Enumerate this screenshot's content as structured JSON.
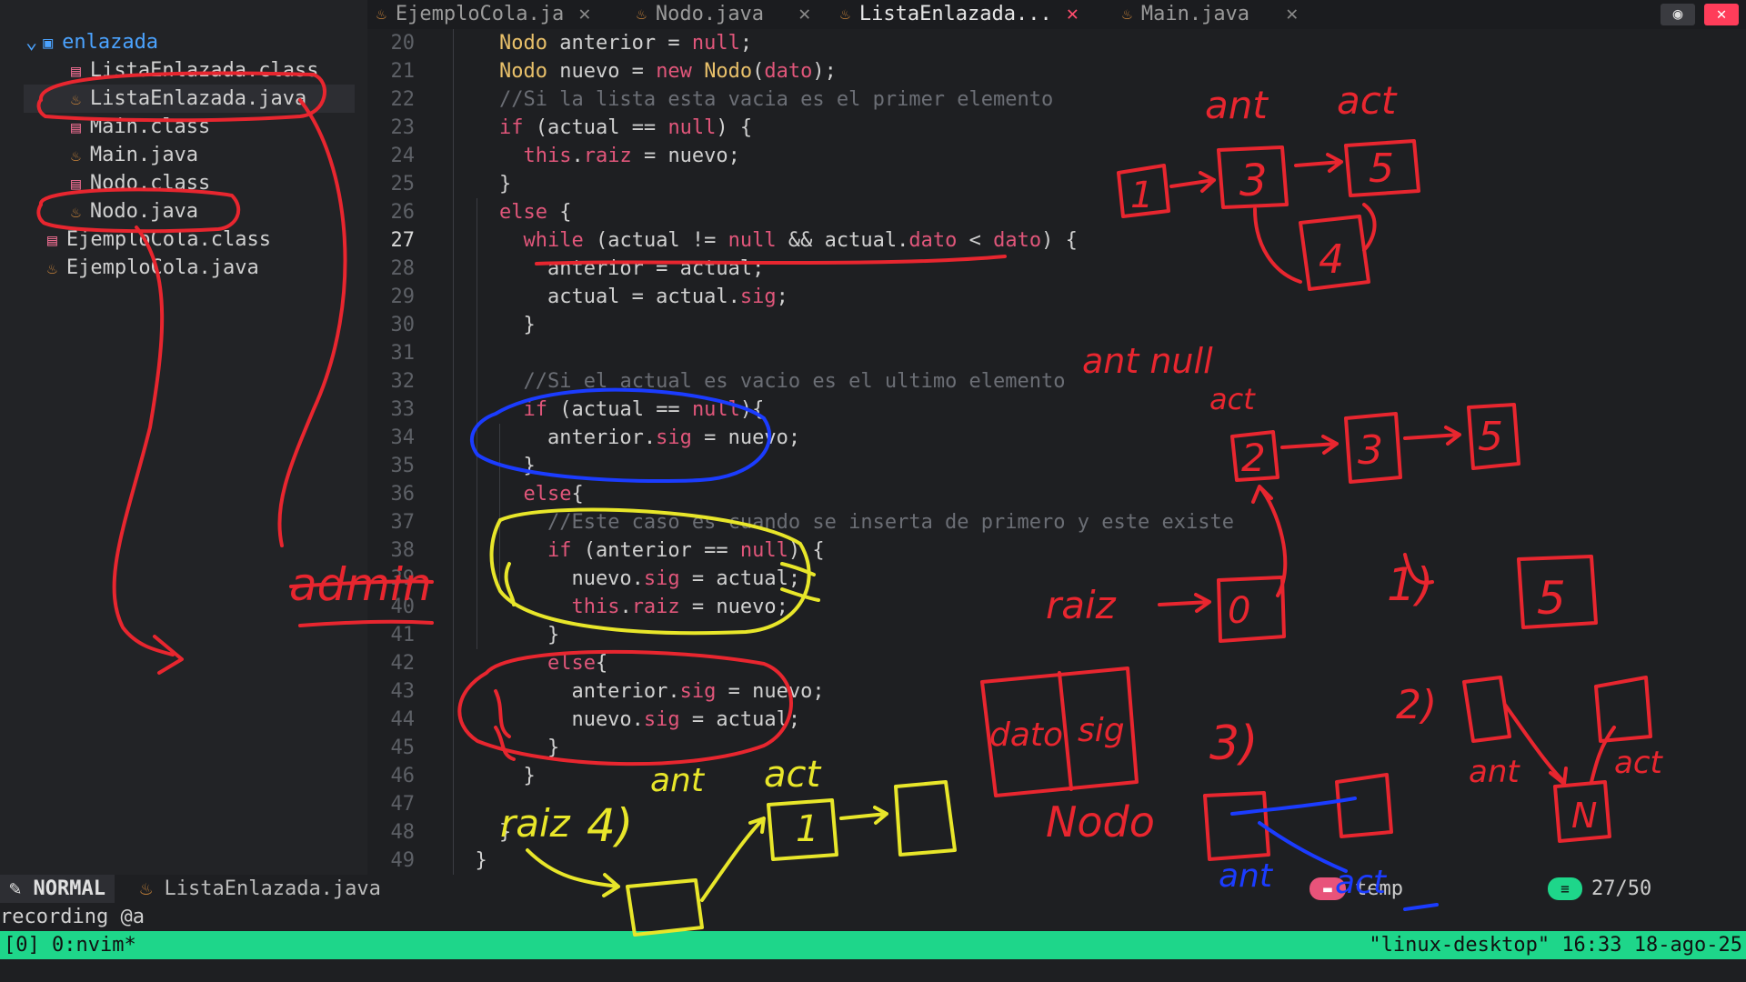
{
  "sidebar": {
    "folder": "enlazada",
    "items": [
      {
        "label": "ListaEnlazada.class",
        "kind": "class"
      },
      {
        "label": "ListaEnlazada.java",
        "kind": "java"
      },
      {
        "label": "Main.class",
        "kind": "class"
      },
      {
        "label": "Main.java",
        "kind": "java"
      },
      {
        "label": "Nodo.class",
        "kind": "class"
      },
      {
        "label": "Nodo.java",
        "kind": "java"
      },
      {
        "label": "EjemploCola.class",
        "kind": "class"
      },
      {
        "label": "EjemploCola.java",
        "kind": "java"
      }
    ]
  },
  "tabs": [
    {
      "label": "EjemploCola.ja",
      "active": false
    },
    {
      "label": "Nodo.java",
      "active": false
    },
    {
      "label": "ListaEnlazada...",
      "active": true
    },
    {
      "label": "Main.java",
      "active": false
    }
  ],
  "editor": {
    "lines": [
      {
        "n": "20",
        "t": "    Nodo anterior = null;"
      },
      {
        "n": "21",
        "t": "    Nodo nuevo = new Nodo(dato);"
      },
      {
        "n": "22",
        "t": "    //Si la lista esta vacia es el primer elemento"
      },
      {
        "n": "23",
        "t": "    if (actual == null) {"
      },
      {
        "n": "24",
        "t": "      this.raiz = nuevo;"
      },
      {
        "n": "25",
        "t": "    }"
      },
      {
        "n": "26",
        "t": "    else {"
      },
      {
        "n": "27",
        "t": "      while (actual != null && actual.dato < dato) {"
      },
      {
        "n": "28",
        "t": "        anterior = actual;"
      },
      {
        "n": "29",
        "t": "        actual = actual.sig;"
      },
      {
        "n": "30",
        "t": "      }"
      },
      {
        "n": "31",
        "t": ""
      },
      {
        "n": "32",
        "t": "      //Si el actual es vacio es el ultimo elemento"
      },
      {
        "n": "33",
        "t": "      if (actual == null){"
      },
      {
        "n": "34",
        "t": "        anterior.sig = nuevo;"
      },
      {
        "n": "35",
        "t": "      }"
      },
      {
        "n": "36",
        "t": "      else{"
      },
      {
        "n": "37",
        "t": "        //Este caso es cuando se inserta de primero y este existe"
      },
      {
        "n": "38",
        "t": "        if (anterior == null) {"
      },
      {
        "n": "39",
        "t": "          nuevo.sig = actual;"
      },
      {
        "n": "40",
        "t": "          this.raiz = nuevo;"
      },
      {
        "n": "41",
        "t": "        }"
      },
      {
        "n": "42",
        "t": "        else{"
      },
      {
        "n": "43",
        "t": "          anterior.sig = nuevo;"
      },
      {
        "n": "44",
        "t": "          nuevo.sig = actual;"
      },
      {
        "n": "45",
        "t": "        }"
      },
      {
        "n": "46",
        "t": "      }"
      },
      {
        "n": "47",
        "t": ""
      },
      {
        "n": "48",
        "t": "    }"
      },
      {
        "n": "49",
        "t": "  }"
      }
    ],
    "current_line": "27"
  },
  "status": {
    "mode": "NORMAL",
    "file": "ListaEnlazada.java",
    "session": "temp",
    "position": "27/50"
  },
  "cmdline": "recording @a",
  "tmux": {
    "window": "[0] 0:nvim*",
    "host": "\"linux-desktop\" 16:33 18-ago-25"
  },
  "annotations": {
    "admin": "admin",
    "ant1": "ant",
    "act1": "act",
    "n1": "1",
    "n3": "3",
    "n5": "5",
    "n4": "4",
    "ant_null": "ant null",
    "act2": "act",
    "m2": "2",
    "m3": "3",
    "m5": "5",
    "raiz": "raiz",
    "zero": "0",
    "one": "1)",
    "five": "5",
    "two": "2)",
    "ant3": "ant",
    "act3": "act",
    "nbox": "N",
    "dato": "dato",
    "sig": "sig",
    "nodo": "Nodo",
    "three": "3)",
    "ant4": "ant",
    "act4": "act",
    "raiz2": "raiz",
    "four": "4)",
    "ant5": "ant",
    "act5": "act",
    "b1": "1",
    "colors": {
      "red": "#e8262f",
      "blue": "#1b3cff",
      "yellow": "#e8e62a"
    }
  }
}
